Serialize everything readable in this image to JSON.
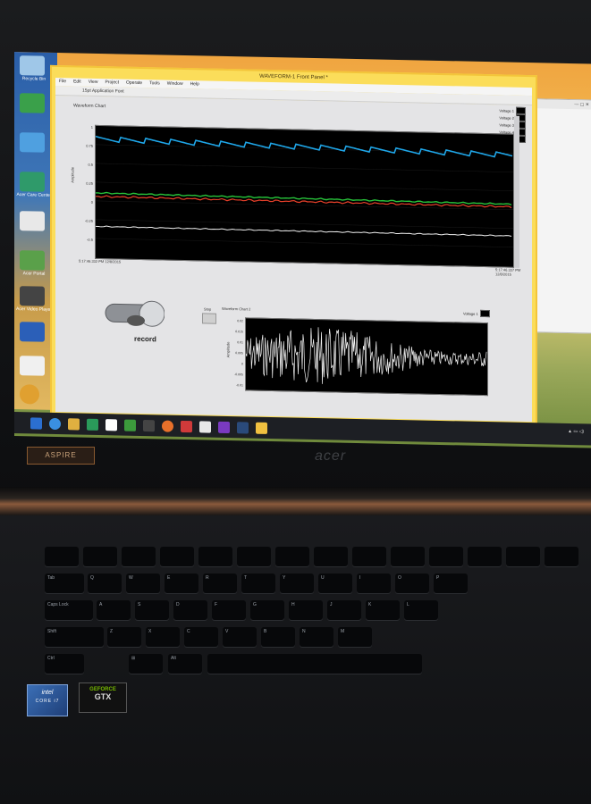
{
  "window": {
    "title": "WAVEFORM-1 Front Panel *",
    "menu": [
      "File",
      "Edit",
      "View",
      "Project",
      "Operate",
      "Tools",
      "Window",
      "Help"
    ],
    "font_dropdown": "15pt Application Font"
  },
  "chart1": {
    "title": "Waveform Chart",
    "ylabel": "Amplitude",
    "yticks": [
      "1",
      "0.75",
      "0.5",
      "0.25",
      "0",
      "-0.25",
      "-0.5"
    ],
    "x_start": "5:17:46.332 PM\n12/8/2015",
    "x_end": "5:17:46.337 PM\n12/8/2015",
    "legend": [
      "Voltage 1",
      "Voltage 2",
      "Voltage 3",
      "Voltage 4",
      "Voltage 5"
    ]
  },
  "chart2": {
    "title": "Waveform Chart 2",
    "ylabel": "Amplitude",
    "yticks": [
      "0.02",
      "0.015",
      "0.01",
      "0.005",
      "0",
      "-0.005",
      "-0.01"
    ],
    "legend": "Voltage 1"
  },
  "controls": {
    "record_label": "record",
    "stop_label": "Stop"
  },
  "desktop_icons": [
    "Recycle Bin",
    "Acer Care Center",
    "Acer Portal",
    "Acer Video Player"
  ],
  "keyboard": {
    "row1": [
      "Q",
      "W",
      "E",
      "R",
      "T",
      "Y",
      "U",
      "I",
      "O",
      "P"
    ],
    "row2": [
      "A",
      "S",
      "D",
      "F",
      "G",
      "H",
      "J",
      "K",
      "L"
    ],
    "row3": [
      "Z",
      "X",
      "C",
      "V",
      "B",
      "N",
      "M"
    ],
    "mods": {
      "tab": "Tab",
      "caps": "Caps Lock",
      "shift": "Shift",
      "ctrl": "Ctrl",
      "alt": "Alt",
      "win": "⊞"
    }
  },
  "bezel": {
    "badge": "ASPIRE",
    "brand": "acer"
  },
  "stickers": {
    "intel_top": "intel",
    "intel_bottom": "CORE i7",
    "nvidia_top": "GEFORCE",
    "nvidia_main": "GTX"
  },
  "colors": {
    "series": [
      "#1fa6e8",
      "#27c23a",
      "#e8402a",
      "#f0f0f0"
    ],
    "window_frame": "#fbdd5a",
    "plot_bg": "#000000"
  }
}
